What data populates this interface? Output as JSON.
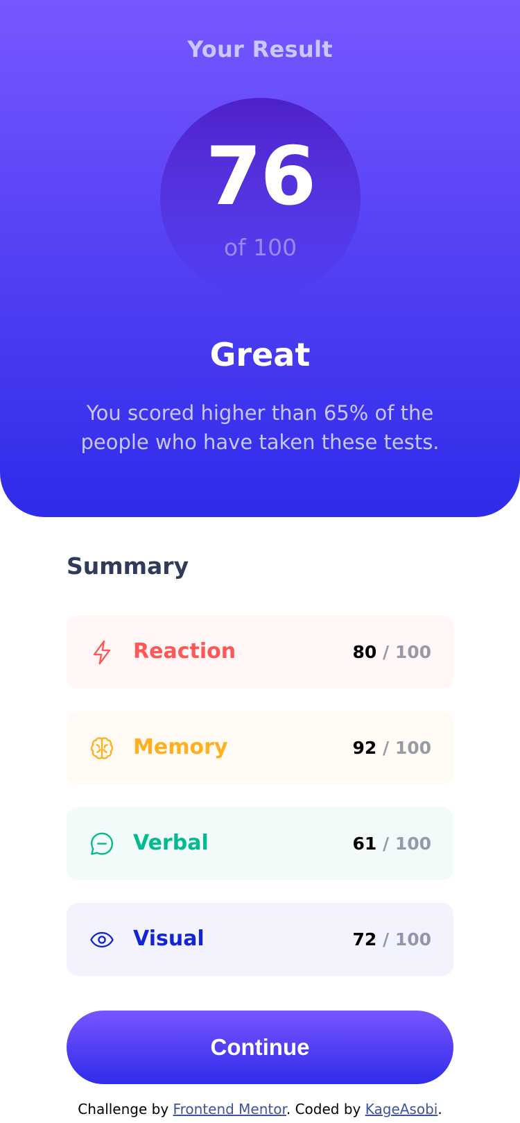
{
  "result": {
    "heading": "Your Result",
    "score": "76",
    "score_total": "of 100",
    "rating": "Great",
    "description": "You scored higher than 65% of the people who have taken these tests."
  },
  "summary": {
    "title": "Summary",
    "items": [
      {
        "label": "Reaction",
        "score": "80",
        "separator": "/",
        "total": "100",
        "icon": "lightning-icon",
        "color": "#ff5757",
        "bg": "#fff6f5"
      },
      {
        "label": "Memory",
        "score": "92",
        "separator": "/",
        "total": "100",
        "icon": "brain-icon",
        "color": "#ffb01f",
        "bg": "#fffbf4"
      },
      {
        "label": "Verbal",
        "score": "61",
        "separator": "/",
        "total": "100",
        "icon": "chat-bubble-icon",
        "color": "#00bb8f",
        "bg": "#f2fbfa"
      },
      {
        "label": "Visual",
        "score": "72",
        "separator": "/",
        "total": "100",
        "icon": "eye-icon",
        "color": "#1125d6",
        "bg": "#f3f3fd"
      }
    ]
  },
  "continue_button": {
    "label": "Continue"
  },
  "attribution": {
    "prefix": "Challenge by",
    "link1": "Frontend Mentor",
    "middle": ". Coded by",
    "link2": "KageAsobi",
    "suffix": "."
  },
  "colors": {
    "gradient_top": "#7857ff",
    "gradient_bottom": "#2e2be9",
    "heading_text": "#303b59",
    "pale_text": "#c8c7ff"
  }
}
